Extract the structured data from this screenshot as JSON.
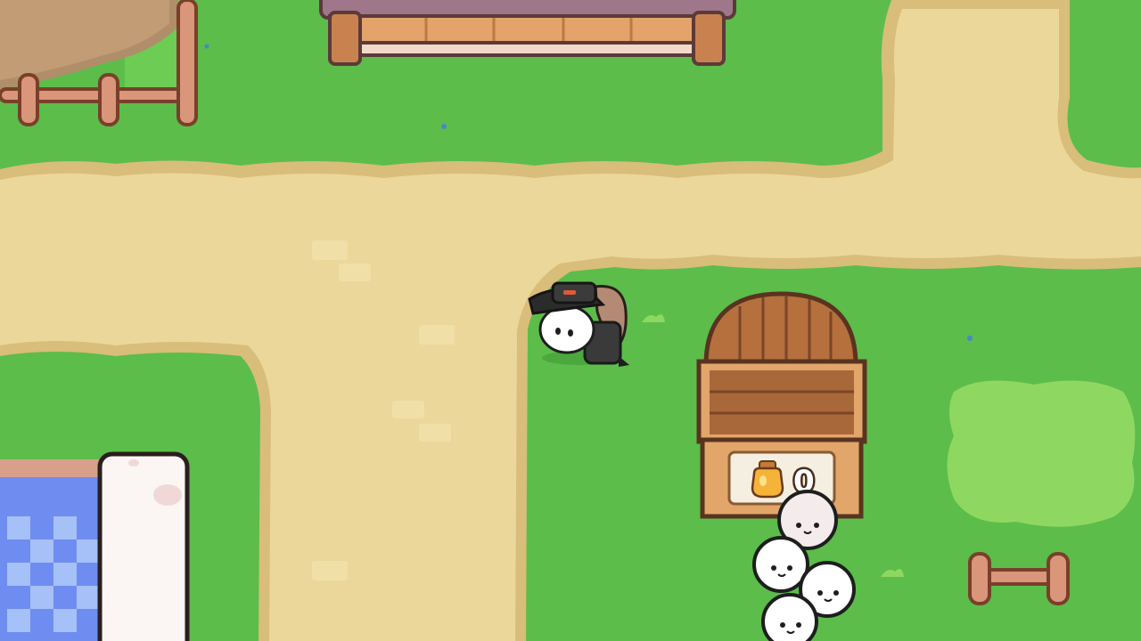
{
  "hud": {
    "honey_counter": {
      "icon": "honey-jar-icon",
      "value": "0"
    }
  },
  "world": {
    "ground": {
      "grass_color": "#5cbd4a",
      "grass_light": "#8ed861",
      "path_color": "#ecd79a",
      "path_edge": "#d9bd7a"
    },
    "objects": [
      "fence-top-left",
      "tilled-dirt-plot",
      "wooden-bench",
      "honey-shop-stall",
      "player-character",
      "sheep-group",
      "fence-bottom-right",
      "water-pool",
      "white-pillar"
    ]
  }
}
